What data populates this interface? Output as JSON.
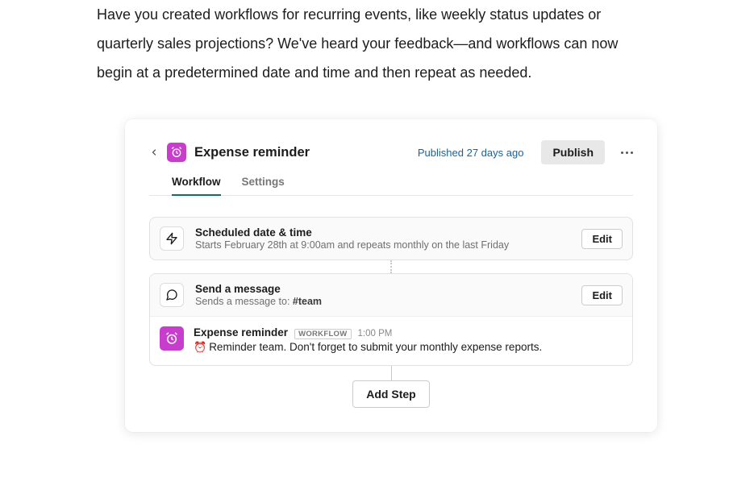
{
  "intro": "Have you created workflows for recurring events, like weekly status updates or quarterly sales projections? We've heard your feedback—and workflows can now begin at a predetermined date and time and then repeat as needed.",
  "header": {
    "title": "Expense reminder",
    "published_time": "Published 27 days ago",
    "publish_button": "Publish"
  },
  "tabs": {
    "workflow": "Workflow",
    "settings": "Settings"
  },
  "steps": {
    "schedule": {
      "title": "Scheduled date & time",
      "subtitle": "Starts February 28th at 9:00am and repeats monthly on the last Friday",
      "edit": "Edit"
    },
    "message": {
      "title": "Send a message",
      "subtitle_prefix": "Sends a message to: ",
      "subtitle_channel": "#team",
      "edit": "Edit",
      "preview": {
        "author": "Expense reminder",
        "badge": "WORKFLOW",
        "time": "1:00 PM",
        "emoji": "⏰",
        "text": "Reminder team. Don't forget to submit your monthly expense reports."
      }
    }
  },
  "add_step": "Add Step"
}
